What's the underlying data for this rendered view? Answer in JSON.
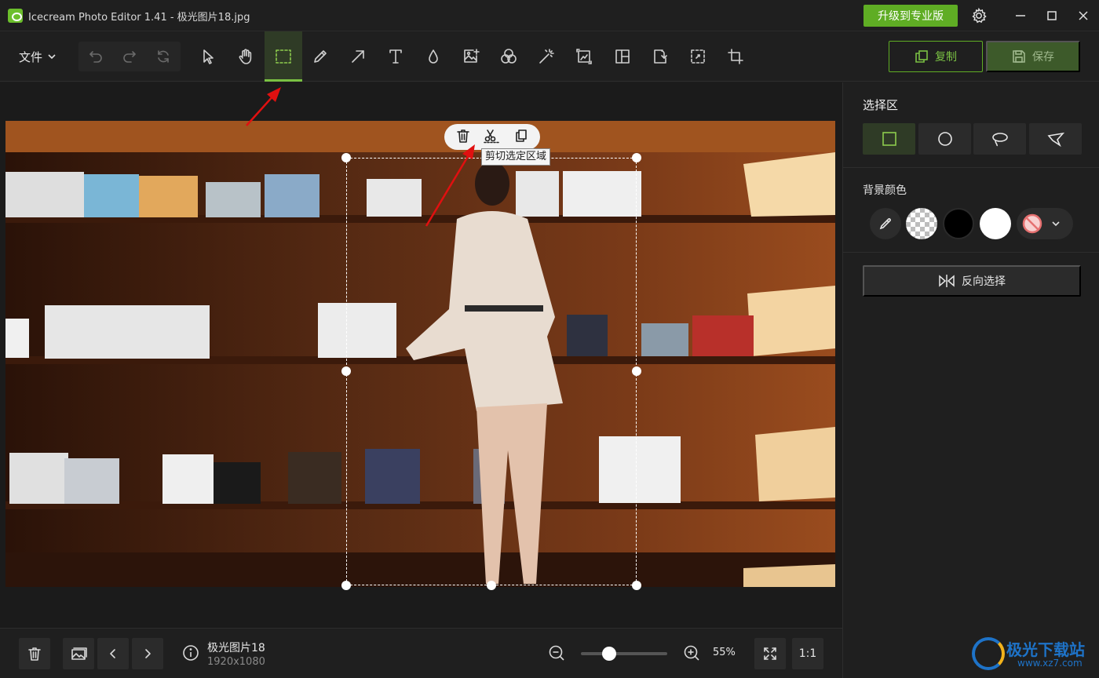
{
  "window": {
    "title": "Icecream Photo Editor 1.41 - 极光图片18.jpg",
    "upgrade_label": "升级到专业版"
  },
  "toolbar": {
    "file_menu_label": "文件",
    "copy_label": "复制",
    "save_label": "保存",
    "tools": [
      "select-pointer",
      "pan",
      "rect-select",
      "pencil",
      "arrow",
      "text",
      "blur-drop",
      "add-image",
      "color-adjust",
      "magic-wand",
      "resize",
      "collage",
      "rotate",
      "crop-selection",
      "crop"
    ],
    "active_tool": "rect-select"
  },
  "canvas": {
    "selection_menu": [
      "delete-icon",
      "cut-icon",
      "copy-icon"
    ],
    "tooltip": "剪切选定区域"
  },
  "panel": {
    "selection_title": "选择区",
    "selection_shapes": [
      "rectangle",
      "ellipse",
      "lasso",
      "polygon"
    ],
    "active_shape": "rectangle",
    "background_label": "背景颜色",
    "background_options": [
      "eyedropper",
      "transparent",
      "black",
      "white",
      "none"
    ],
    "invert_label": "反向选择"
  },
  "footer": {
    "file_name": "极光图片18",
    "file_dimensions": "1920x1080",
    "zoom_label": "55%",
    "zoom_value": 0.55,
    "ratio_label": "1:1"
  },
  "watermark": {
    "main": "极光下载站",
    "sub": "www.xz7.com"
  },
  "colors": {
    "accent": "#5fad24",
    "active_tool_bg": "#2f3b26",
    "annotation_arrow": "#e01010"
  }
}
